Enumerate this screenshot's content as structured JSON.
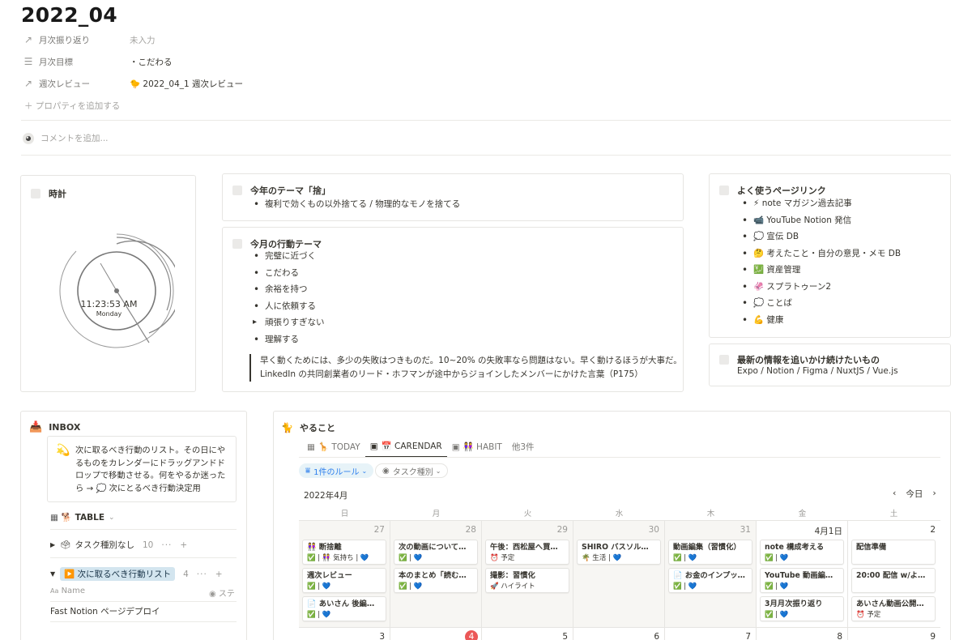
{
  "page": {
    "title": "2022_04",
    "properties": [
      {
        "icon": "↗",
        "name": "月次振り返り",
        "value": "未入力",
        "empty": true
      },
      {
        "icon": "☰",
        "name": "月次目標",
        "value": "・こだわる",
        "empty": false
      },
      {
        "icon": "↗",
        "name": "週次レビュー",
        "value": "🐤 2022_04_1 週次レビュー",
        "empty": false
      }
    ],
    "add_property": "＋ プロパティを追加する",
    "comment_placeholder": "コメントを追加..."
  },
  "clock": {
    "heading": "時計",
    "time": "11:23:53 AM",
    "day": "Monday"
  },
  "theme_year": {
    "heading": "今年のテーマ「捨」",
    "items": [
      "複利で効くもの以外捨てる / 物理的なモノを捨てる"
    ]
  },
  "theme_month": {
    "heading": "今月の行動テーマ",
    "items": [
      "完璧に近づく",
      "こだわる",
      "余裕を持つ",
      "人に依頼する",
      "頑張りすぎない",
      "理解する"
    ],
    "quote_line1": "早く動くためには、多少の失敗はつきものだ。10~20% の失敗率なら問題はない。早く動けるほうが大事だ。",
    "quote_line2": "LinkedIn の共同創業者のリード・ホフマンが途中からジョインしたメンバーにかけた言葉（P175）"
  },
  "links": {
    "heading": "よく使うページリンク",
    "items": [
      {
        "emoji": "⚡",
        "label": "note マガジン過去記事"
      },
      {
        "emoji": "📹",
        "label": "YouTube Notion 発信"
      },
      {
        "emoji": "💭",
        "label": "宣伝 DB"
      },
      {
        "emoji": "🤔",
        "label": "考えたこと・自分の意見・メモ DB"
      },
      {
        "emoji": "💹",
        "label": "資産管理"
      },
      {
        "emoji": "🦑",
        "label": "スプラトゥーン2"
      },
      {
        "emoji": "💭",
        "label": "ことば"
      },
      {
        "emoji": "💪",
        "label": "健康"
      }
    ]
  },
  "latest": {
    "heading": "最新の情報を追いかけ続けたいもの",
    "text": "Expo / Notion / Figma / NuxtJS / Vue.js"
  },
  "inbox": {
    "heading": "INBOX",
    "callout": "次に取るべき行動のリスト。その日にやるものをカレンダーにドラッグアンドドロップで移動させる。何をやるか迷ったら → 💭 次にとるべき行動決定用",
    "view_label": "🐕 TABLE",
    "group1_label": "タスク種別なし",
    "group1_count": "10",
    "group2_label": "▶️ 次に取るべき行動リスト",
    "group2_count": "4",
    "col_name": "Name",
    "col_status": "ステ",
    "row1": "Fast Notion ページデプロイ",
    "more_dots": "···",
    "plus": "+"
  },
  "todo": {
    "heading": "やること",
    "tabs": [
      {
        "label": "🦒 TODAY",
        "icon": "table-icon",
        "active": false
      },
      {
        "label": "📅 CARENDAR",
        "icon": "calendar-icon",
        "active": true
      },
      {
        "label": "👭 HABIT",
        "icon": "calendar-icon",
        "active": false
      },
      {
        "label": "他3件",
        "icon": "",
        "active": false
      }
    ],
    "filter_rule": "1件のルール",
    "filter_type": "タスク種別",
    "month": "2022年4月",
    "today_btn": "今日",
    "weekdays": [
      "日",
      "月",
      "火",
      "水",
      "木",
      "金",
      "土"
    ],
    "week1_days": [
      "27",
      "28",
      "29",
      "30",
      "31",
      "4月1日",
      "2"
    ],
    "week2_days": [
      "3",
      "4",
      "5",
      "6",
      "7",
      "8",
      "9"
    ],
    "cards": [
      [
        {
          "title": "👭 断捨離",
          "props": "✅ | 👭 気持ち | 💙"
        },
        {
          "title": "週次レビュー",
          "props": "✅ | 💙"
        },
        {
          "title": "📄 あいさん 後編編集",
          "props": "✅ | 💙"
        }
      ],
      [
        {
          "title": "次の動画について考え...",
          "props": "✅ | 💙"
        },
        {
          "title": "本のまとめ「読む力大...",
          "props": "✅ | 💙"
        }
      ],
      [
        {
          "title": "午後：西松屋へ買い物...",
          "props": "⏰ 予定"
        },
        {
          "title": "撮影：習慣化",
          "props": "🚀 ハイライト"
        }
      ],
      [
        {
          "title": "SHIRO バスソルト購入",
          "props": "🌴 生活 | 💙"
        }
      ],
      [
        {
          "title": "動画編集（習慣化）",
          "props": "✅ | 💙"
        },
        {
          "title": "📄 お金のインプット・...",
          "props": "✅ | 💙"
        }
      ],
      [
        {
          "title": "note 構成考える",
          "props": "✅ | 💙"
        },
        {
          "title": "YouTube 動画編集価...",
          "props": "✅ | 💙"
        },
        {
          "title": "3月月次振り返り",
          "props": "✅ | 💙"
        }
      ],
      [
        {
          "title": "配信準備",
          "props": ""
        },
        {
          "title": "20:00 配信 w/よねざ...",
          "props": ""
        },
        {
          "title": "あいさん動画公開予定",
          "props": "⏰ 予定"
        }
      ]
    ]
  }
}
